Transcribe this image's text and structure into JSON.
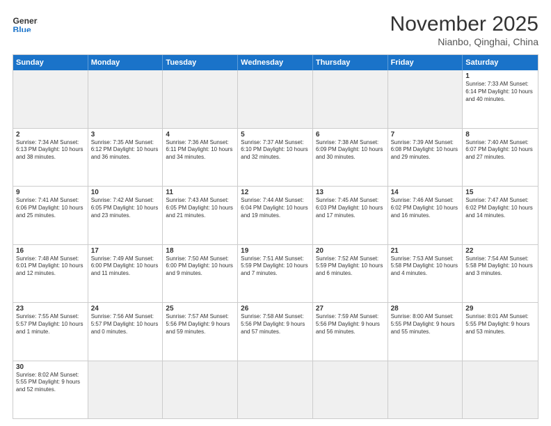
{
  "logo": {
    "general": "General",
    "blue": "Blue"
  },
  "title": "November 2025",
  "subtitle": "Nianbo, Qinghai, China",
  "days": {
    "headers": [
      "Sunday",
      "Monday",
      "Tuesday",
      "Wednesday",
      "Thursday",
      "Friday",
      "Saturday"
    ]
  },
  "weeks": [
    [
      {
        "num": "",
        "info": "",
        "empty": true
      },
      {
        "num": "",
        "info": "",
        "empty": true
      },
      {
        "num": "",
        "info": "",
        "empty": true
      },
      {
        "num": "",
        "info": "",
        "empty": true
      },
      {
        "num": "",
        "info": "",
        "empty": true
      },
      {
        "num": "",
        "info": "",
        "empty": true
      },
      {
        "num": "1",
        "info": "Sunrise: 7:33 AM\nSunset: 6:14 PM\nDaylight: 10 hours and 40 minutes.",
        "empty": false
      }
    ],
    [
      {
        "num": "2",
        "info": "Sunrise: 7:34 AM\nSunset: 6:13 PM\nDaylight: 10 hours and 38 minutes.",
        "empty": false
      },
      {
        "num": "3",
        "info": "Sunrise: 7:35 AM\nSunset: 6:12 PM\nDaylight: 10 hours and 36 minutes.",
        "empty": false
      },
      {
        "num": "4",
        "info": "Sunrise: 7:36 AM\nSunset: 6:11 PM\nDaylight: 10 hours and 34 minutes.",
        "empty": false
      },
      {
        "num": "5",
        "info": "Sunrise: 7:37 AM\nSunset: 6:10 PM\nDaylight: 10 hours and 32 minutes.",
        "empty": false
      },
      {
        "num": "6",
        "info": "Sunrise: 7:38 AM\nSunset: 6:09 PM\nDaylight: 10 hours and 30 minutes.",
        "empty": false
      },
      {
        "num": "7",
        "info": "Sunrise: 7:39 AM\nSunset: 6:08 PM\nDaylight: 10 hours and 29 minutes.",
        "empty": false
      },
      {
        "num": "8",
        "info": "Sunrise: 7:40 AM\nSunset: 6:07 PM\nDaylight: 10 hours and 27 minutes.",
        "empty": false
      }
    ],
    [
      {
        "num": "9",
        "info": "Sunrise: 7:41 AM\nSunset: 6:06 PM\nDaylight: 10 hours and 25 minutes.",
        "empty": false
      },
      {
        "num": "10",
        "info": "Sunrise: 7:42 AM\nSunset: 6:05 PM\nDaylight: 10 hours and 23 minutes.",
        "empty": false
      },
      {
        "num": "11",
        "info": "Sunrise: 7:43 AM\nSunset: 6:05 PM\nDaylight: 10 hours and 21 minutes.",
        "empty": false
      },
      {
        "num": "12",
        "info": "Sunrise: 7:44 AM\nSunset: 6:04 PM\nDaylight: 10 hours and 19 minutes.",
        "empty": false
      },
      {
        "num": "13",
        "info": "Sunrise: 7:45 AM\nSunset: 6:03 PM\nDaylight: 10 hours and 17 minutes.",
        "empty": false
      },
      {
        "num": "14",
        "info": "Sunrise: 7:46 AM\nSunset: 6:02 PM\nDaylight: 10 hours and 16 minutes.",
        "empty": false
      },
      {
        "num": "15",
        "info": "Sunrise: 7:47 AM\nSunset: 6:02 PM\nDaylight: 10 hours and 14 minutes.",
        "empty": false
      }
    ],
    [
      {
        "num": "16",
        "info": "Sunrise: 7:48 AM\nSunset: 6:01 PM\nDaylight: 10 hours and 12 minutes.",
        "empty": false
      },
      {
        "num": "17",
        "info": "Sunrise: 7:49 AM\nSunset: 6:00 PM\nDaylight: 10 hours and 11 minutes.",
        "empty": false
      },
      {
        "num": "18",
        "info": "Sunrise: 7:50 AM\nSunset: 6:00 PM\nDaylight: 10 hours and 9 minutes.",
        "empty": false
      },
      {
        "num": "19",
        "info": "Sunrise: 7:51 AM\nSunset: 5:59 PM\nDaylight: 10 hours and 7 minutes.",
        "empty": false
      },
      {
        "num": "20",
        "info": "Sunrise: 7:52 AM\nSunset: 5:59 PM\nDaylight: 10 hours and 6 minutes.",
        "empty": false
      },
      {
        "num": "21",
        "info": "Sunrise: 7:53 AM\nSunset: 5:58 PM\nDaylight: 10 hours and 4 minutes.",
        "empty": false
      },
      {
        "num": "22",
        "info": "Sunrise: 7:54 AM\nSunset: 5:58 PM\nDaylight: 10 hours and 3 minutes.",
        "empty": false
      }
    ],
    [
      {
        "num": "23",
        "info": "Sunrise: 7:55 AM\nSunset: 5:57 PM\nDaylight: 10 hours and 1 minute.",
        "empty": false
      },
      {
        "num": "24",
        "info": "Sunrise: 7:56 AM\nSunset: 5:57 PM\nDaylight: 10 hours and 0 minutes.",
        "empty": false
      },
      {
        "num": "25",
        "info": "Sunrise: 7:57 AM\nSunset: 5:56 PM\nDaylight: 9 hours and 59 minutes.",
        "empty": false
      },
      {
        "num": "26",
        "info": "Sunrise: 7:58 AM\nSunset: 5:56 PM\nDaylight: 9 hours and 57 minutes.",
        "empty": false
      },
      {
        "num": "27",
        "info": "Sunrise: 7:59 AM\nSunset: 5:56 PM\nDaylight: 9 hours and 56 minutes.",
        "empty": false
      },
      {
        "num": "28",
        "info": "Sunrise: 8:00 AM\nSunset: 5:55 PM\nDaylight: 9 hours and 55 minutes.",
        "empty": false
      },
      {
        "num": "29",
        "info": "Sunrise: 8:01 AM\nSunset: 5:55 PM\nDaylight: 9 hours and 53 minutes.",
        "empty": false
      }
    ],
    [
      {
        "num": "30",
        "info": "Sunrise: 8:02 AM\nSunset: 5:55 PM\nDaylight: 9 hours and 52 minutes.",
        "empty": false
      },
      {
        "num": "",
        "info": "",
        "empty": true
      },
      {
        "num": "",
        "info": "",
        "empty": true
      },
      {
        "num": "",
        "info": "",
        "empty": true
      },
      {
        "num": "",
        "info": "",
        "empty": true
      },
      {
        "num": "",
        "info": "",
        "empty": true
      },
      {
        "num": "",
        "info": "",
        "empty": true
      }
    ]
  ]
}
